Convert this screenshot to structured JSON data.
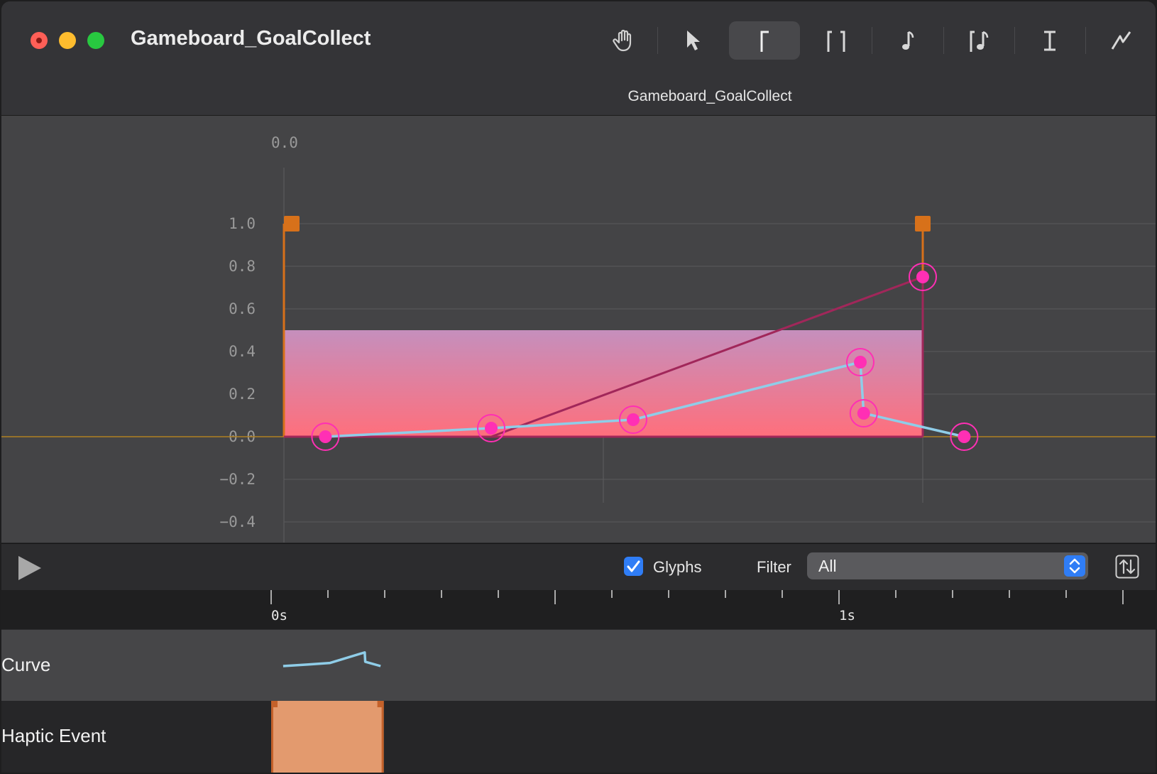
{
  "window": {
    "title": "Gameboard_GoalCollect",
    "document_title": "Gameboard_GoalCollect"
  },
  "toolbar": {
    "tools": [
      {
        "name": "hand-tool",
        "icon": "hand-icon",
        "active": false
      },
      {
        "name": "select-tool",
        "icon": "arrow-pointer-icon",
        "active": false
      },
      {
        "name": "transient-event-tool",
        "icon": "transient-bracket-icon",
        "active": true
      },
      {
        "name": "continuous-event-tool",
        "icon": "continuous-brackets-icon",
        "active": false
      },
      {
        "name": "audio-tool",
        "icon": "music-note-icon",
        "active": false
      },
      {
        "name": "audio-continuous-tool",
        "icon": "bracket-note-icon",
        "active": false
      },
      {
        "name": "text-cursor-tool",
        "icon": "i-beam-icon",
        "active": false
      },
      {
        "name": "curve-tool",
        "icon": "curve-line-icon",
        "active": false
      }
    ]
  },
  "graph": {
    "top_value_label": "0.0",
    "y_ticks": [
      "1.0",
      "0.8",
      "0.6",
      "0.4",
      "0.2",
      "0.0",
      "−0.2",
      "−0.4"
    ],
    "colors": {
      "event_fill_top": "#c58fbd",
      "event_fill_bottom": "#ff6f7c",
      "event_border": "#d7711a",
      "curve_line": "#8fcde8",
      "sharpness_line": "#a1275a",
      "control_point": "#ff2fb4",
      "baseline": "#b08020"
    },
    "event": {
      "start_s": 0.0,
      "end_s": 1.125,
      "intensity": 0.5
    },
    "intensity_curve": [
      {
        "t": 0.073,
        "v": 0.0
      },
      {
        "t": 0.365,
        "v": 0.04
      },
      {
        "t": 0.615,
        "v": 0.08
      },
      {
        "t": 1.015,
        "v": 0.35
      },
      {
        "t": 1.021,
        "v": 0.11
      },
      {
        "t": 1.198,
        "v": 0.0
      }
    ],
    "sharpness_line": [
      {
        "t": 0.365,
        "v": 0.0
      },
      {
        "t": 1.125,
        "v": 0.75
      }
    ]
  },
  "controls": {
    "glyphs_label": "Glyphs",
    "glyphs_checked": true,
    "filter_label": "Filter",
    "filter_value": "All"
  },
  "timeline": {
    "labels": [
      {
        "text": "0s",
        "t": 0
      },
      {
        "text": "1s",
        "t": 1
      }
    ]
  },
  "tracks": {
    "curve_label": "Curve",
    "haptic_label": "Haptic Event",
    "haptic_color": "#e39a6e",
    "haptic_border": "#c4612a"
  }
}
